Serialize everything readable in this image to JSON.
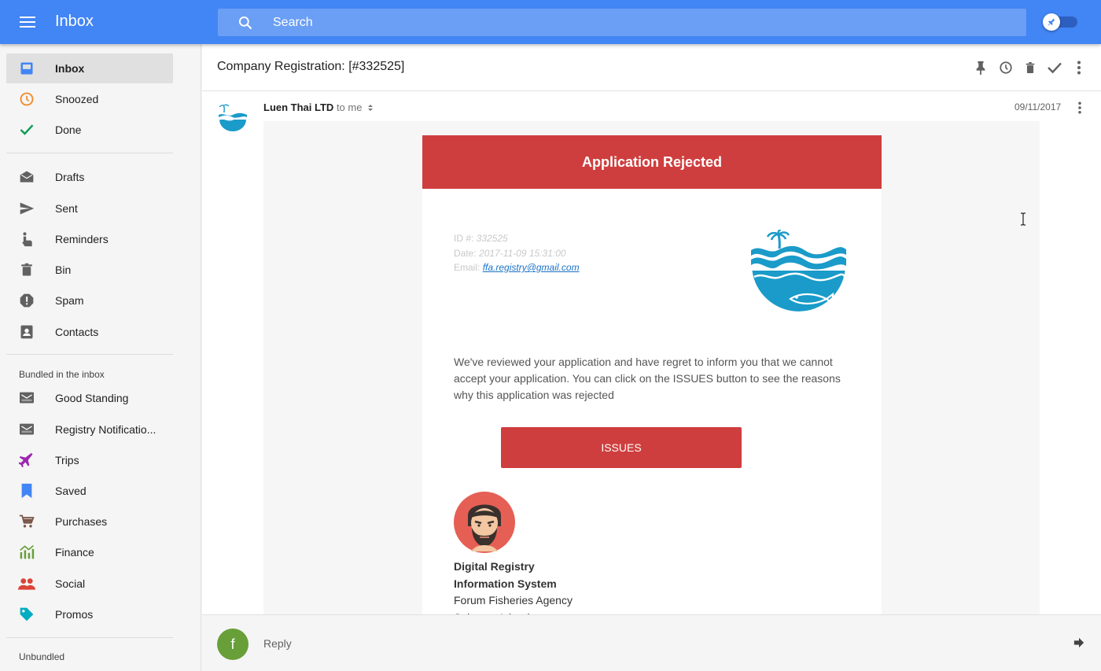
{
  "topbar": {
    "title": "Inbox",
    "search_placeholder": "Search"
  },
  "sidebar": {
    "main_items": [
      {
        "label": "Inbox",
        "icon": "inbox-icon",
        "color": "#4285f4",
        "active": true
      },
      {
        "label": "Snoozed",
        "icon": "clock-icon",
        "color": "#ef8b29"
      },
      {
        "label": "Done",
        "icon": "check-icon",
        "color": "#0f9d58"
      }
    ],
    "folder_items": [
      {
        "label": "Drafts",
        "icon": "drafts-icon"
      },
      {
        "label": "Sent",
        "icon": "send-icon"
      },
      {
        "label": "Reminders",
        "icon": "reminder-hand-icon"
      },
      {
        "label": "Bin",
        "icon": "trash-icon"
      },
      {
        "label": "Spam",
        "icon": "spam-icon"
      },
      {
        "label": "Contacts",
        "icon": "contacts-icon"
      }
    ],
    "bundled_heading": "Bundled in the inbox",
    "bundled_items": [
      {
        "label": "Good Standing",
        "icon": "bundle-icon",
        "color": "#616161"
      },
      {
        "label": "Registry Notificatio...",
        "icon": "bundle-icon",
        "color": "#616161"
      },
      {
        "label": "Trips",
        "icon": "plane-icon",
        "color": "#9c27b0"
      },
      {
        "label": "Saved",
        "icon": "bookmark-icon",
        "color": "#4285f4"
      },
      {
        "label": "Purchases",
        "icon": "cart-icon",
        "color": "#795548"
      },
      {
        "label": "Finance",
        "icon": "finance-icon",
        "color": "#689f38"
      },
      {
        "label": "Social",
        "icon": "people-icon",
        "color": "#db4437"
      },
      {
        "label": "Promos",
        "icon": "tag-icon",
        "color": "#00acc1"
      }
    ],
    "unbundled_heading": "Unbundled"
  },
  "email": {
    "subject": "Company Registration: [#332525]",
    "sender": "Luen Thai LTD",
    "to": "to me",
    "date": "09/11/2017",
    "banner": "Application Rejected",
    "meta": {
      "id_label": "ID #:",
      "id_value": "332525",
      "date_label": "Date:",
      "date_value": "2017-11-09 15:31:00",
      "email_label": "Email:",
      "email_value": "ffa.registry@gmail.com"
    },
    "body": "We've reviewed your application and have regret to inform you that we cannot accept your application. You can click on the ISSUES button to see the reasons why this application was rejected",
    "button": "ISSUES",
    "signature": {
      "line1": "Digital Registry",
      "line2": "Information System",
      "line3": "Forum Fisheries Agency",
      "line4": "Solomon Islands"
    }
  },
  "reply": {
    "avatar_letter": "f",
    "label": "Reply"
  },
  "colors": {
    "topbar": "#4285f4",
    "banner": "#cf3e3e",
    "reply_avatar": "#689f38"
  }
}
